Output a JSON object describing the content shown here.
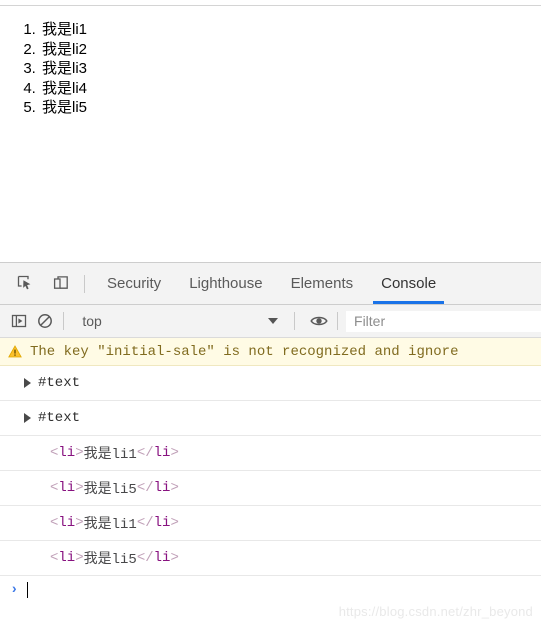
{
  "page": {
    "list_type": "ordered",
    "items": [
      {
        "label": "我是li1"
      },
      {
        "label": "我是li2"
      },
      {
        "label": "我是li3"
      },
      {
        "label": "我是li4"
      },
      {
        "label": "我是li5"
      }
    ]
  },
  "devtools": {
    "tabbar": {
      "inspect_icon": "inspect-element-icon",
      "device_icon": "device-toolbar-icon",
      "tabs": [
        {
          "label": "Security",
          "selected": false
        },
        {
          "label": "Lighthouse",
          "selected": false
        },
        {
          "label": "Elements",
          "selected": false
        },
        {
          "label": "Console",
          "selected": true
        }
      ],
      "active_tab": "Console",
      "accent_color": "#1a73e8"
    },
    "toolbar": {
      "sidebar_toggle_icon": "console-sidebar-icon",
      "clear_icon": "clear-console-icon",
      "context_value": "top",
      "context_caret_icon": "chevron-down-icon",
      "eye_icon": "live-expression-eye-icon",
      "filter_placeholder": "Filter",
      "filter_value": ""
    },
    "messages": [
      {
        "kind": "warning",
        "icon": "warning-triangle-icon",
        "text": "The key \"initial-sale\" is not recognized and ignore",
        "truncated": true,
        "bg_color": "#fffbe5",
        "text_color": "#806b1f"
      },
      {
        "kind": "node",
        "disclosure_icon": "disclosure-triangle-icon",
        "text": "#text"
      },
      {
        "kind": "node",
        "disclosure_icon": "disclosure-triangle-icon",
        "text": "#text"
      },
      {
        "kind": "html",
        "open_bracket": "<",
        "tag": "li",
        "content": "我是li1",
        "close_bracket": "</",
        "close_tag": "li",
        "end_bracket": ">",
        "open_end": ">"
      },
      {
        "kind": "html",
        "open_bracket": "<",
        "tag": "li",
        "content": "我是li5",
        "close_bracket": "</",
        "close_tag": "li",
        "end_bracket": ">",
        "open_end": ">"
      },
      {
        "kind": "html",
        "open_bracket": "<",
        "tag": "li",
        "content": "我是li1",
        "close_bracket": "</",
        "close_tag": "li",
        "end_bracket": ">",
        "open_end": ">"
      },
      {
        "kind": "html",
        "open_bracket": "<",
        "tag": "li",
        "content": "我是li5",
        "close_bracket": "</",
        "close_tag": "li",
        "end_bracket": ">",
        "open_end": ">"
      }
    ],
    "prompt": {
      "chevron": "›",
      "value": ""
    }
  },
  "watermark": {
    "text": "https://blog.csdn.net/zhr_beyond"
  }
}
